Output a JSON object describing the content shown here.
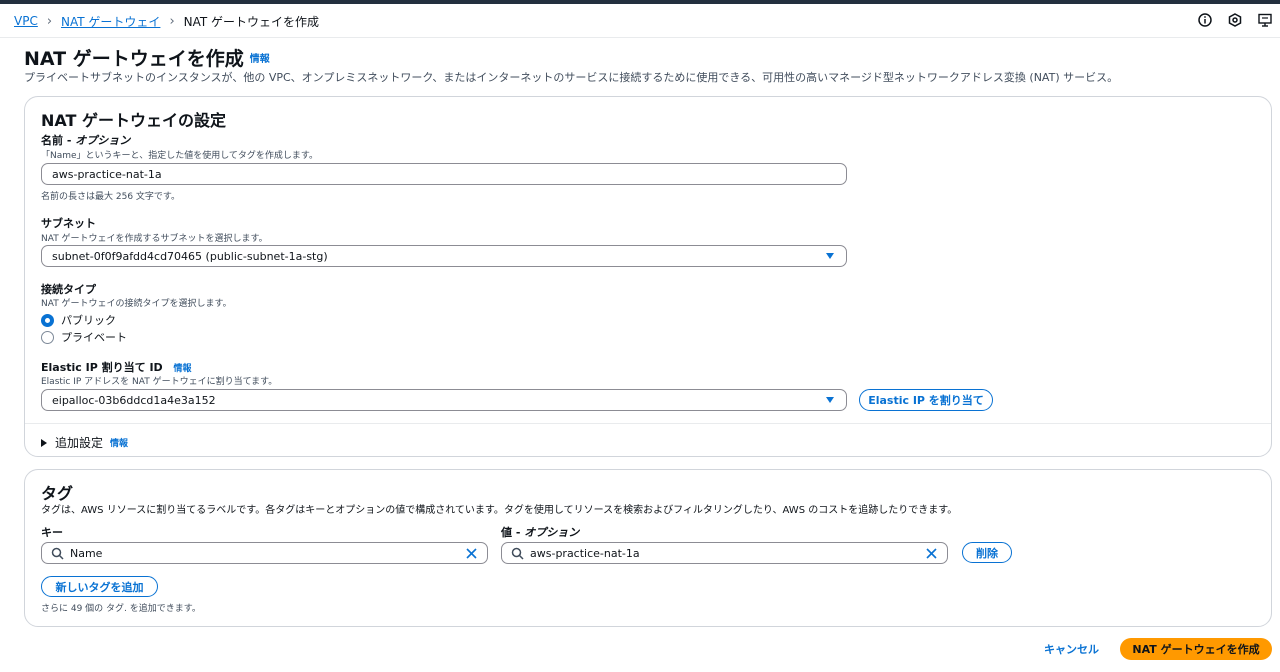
{
  "breadcrumb": {
    "items": [
      "VPC",
      "NAT ゲートウェイ"
    ],
    "current": "NAT ゲートウェイを作成"
  },
  "top_icons": [
    "info-circle-icon",
    "settings-hex-icon",
    "feedback-icon"
  ],
  "page": {
    "title": "NAT ゲートウェイを作成",
    "info": "情報",
    "description": "プライベートサブネットのインスタンスが、他の VPC、オンプレミスネットワーク、またはインターネットのサービスに接続するために使用できる、可用性の高いマネージド型ネットワークアドレス変換 (NAT) サービス。"
  },
  "settings": {
    "title": "NAT ゲートウェイの設定",
    "name": {
      "label": "名前",
      "label_suffix": "オプション",
      "description": "「Name」というキーと、指定した値を使用してタグを作成します。",
      "value": "aws-practice-nat-1a",
      "hint": "名前の長さは最大 256 文字です。"
    },
    "subnet": {
      "label": "サブネット",
      "description": "NAT ゲートウェイを作成するサブネットを選択します。",
      "value": "subnet-0f0f9afdd4cd70465 (public-subnet-1a-stg)"
    },
    "connectivity": {
      "label": "接続タイプ",
      "description": "NAT ゲートウェイの接続タイプを選択します。",
      "options": [
        "パブリック",
        "プライベート"
      ],
      "selected": "パブリック"
    },
    "eip": {
      "label": "Elastic IP 割り当て ID",
      "info": "情報",
      "description": "Elastic IP アドレスを NAT ゲートウェイに割り当てます。",
      "value": "eipalloc-03b6ddcd1a4e3a152",
      "allocate_button": "Elastic IP を割り当て"
    },
    "additional": {
      "label": "追加設定",
      "info": "情報"
    }
  },
  "tags": {
    "title": "タグ",
    "description": "タグは、AWS リソースに割り当てるラベルです。各タグはキーとオプションの値で構成されています。タグを使用してリソースを検索およびフィルタリングしたり、AWS のコストを追跡したりできます。",
    "key_label": "キー",
    "value_label": "値",
    "value_label_suffix": "オプション",
    "key_value": "Name",
    "value_value": "aws-practice-nat-1a",
    "remove_button": "削除",
    "add_button": "新しいタグを追加",
    "remaining": "さらに 49 個の タグ. を追加できます。"
  },
  "footer": {
    "cancel": "キャンセル",
    "create": "NAT ゲートウェイを作成"
  },
  "colors": {
    "accent": "#0972d3",
    "primary_button": "#ff9900",
    "text": "#0f141a",
    "border": "#8c8c94"
  }
}
